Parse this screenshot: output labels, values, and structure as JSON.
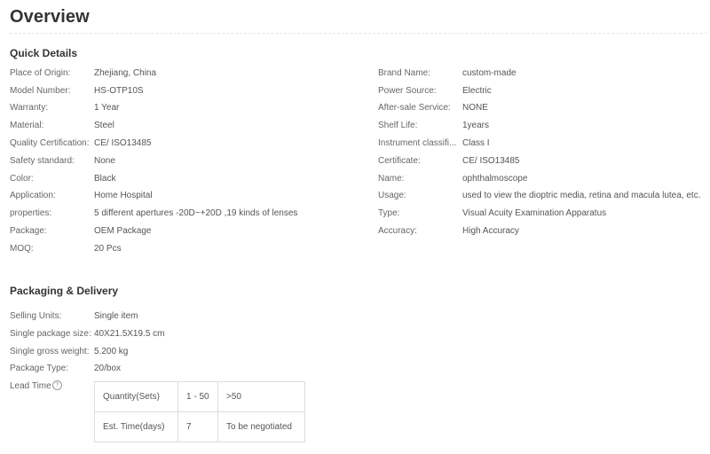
{
  "overview": {
    "title": "Overview"
  },
  "quick_details": {
    "title": "Quick Details",
    "left": [
      {
        "label": "Place of Origin:",
        "value": "Zhejiang, China"
      },
      {
        "label": "Model Number:",
        "value": "HS-OTP10S"
      },
      {
        "label": "Warranty:",
        "value": "1 Year"
      },
      {
        "label": "Material:",
        "value": "Steel"
      },
      {
        "label": "Quality Certification:",
        "value": "CE/ ISO13485"
      },
      {
        "label": "Safety standard:",
        "value": "None"
      },
      {
        "label": "Color:",
        "value": "Black"
      },
      {
        "label": "Application:",
        "value": "Home Hospital"
      },
      {
        "label": "properties:",
        "value": "5 different apertures -20D~+20D ,19 kinds of lenses"
      },
      {
        "label": "Package:",
        "value": "OEM Package"
      },
      {
        "label": "MOQ:",
        "value": "20 Pcs"
      }
    ],
    "right": [
      {
        "label": "Brand Name:",
        "value": "custom-made"
      },
      {
        "label": "Power Source:",
        "value": "Electric"
      },
      {
        "label": "After-sale Service:",
        "value": "NONE"
      },
      {
        "label": "Shelf Life:",
        "value": "1years"
      },
      {
        "label": "Instrument classifi...",
        "value": "Class I"
      },
      {
        "label": "Certificate:",
        "value": "CE/ ISO13485"
      },
      {
        "label": "Name:",
        "value": "ophthalmoscope"
      },
      {
        "label": "Usage:",
        "value": "used to view the dioptric media, retina and macula lutea, etc."
      },
      {
        "label": "Type:",
        "value": "Visual Acuity Examination Apparatus"
      },
      {
        "label": "Accuracy:",
        "value": "High Accuracy"
      }
    ]
  },
  "packaging": {
    "title": "Packaging & Delivery",
    "rows": [
      {
        "label": "Selling Units:",
        "value": "Single item"
      },
      {
        "label": "Single package size:",
        "value": "40X21.5X19.5 cm"
      },
      {
        "label": "Single gross weight:",
        "value": "5.200 kg"
      },
      {
        "label": "Package Type:",
        "value": "20/box"
      }
    ],
    "lead_time": {
      "label": "Lead Time",
      "help_glyph": "?",
      "table": [
        [
          "Quantity(Sets)",
          "1 - 50",
          ">50"
        ],
        [
          "Est. Time(days)",
          "7",
          "To be negotiated"
        ]
      ]
    }
  }
}
